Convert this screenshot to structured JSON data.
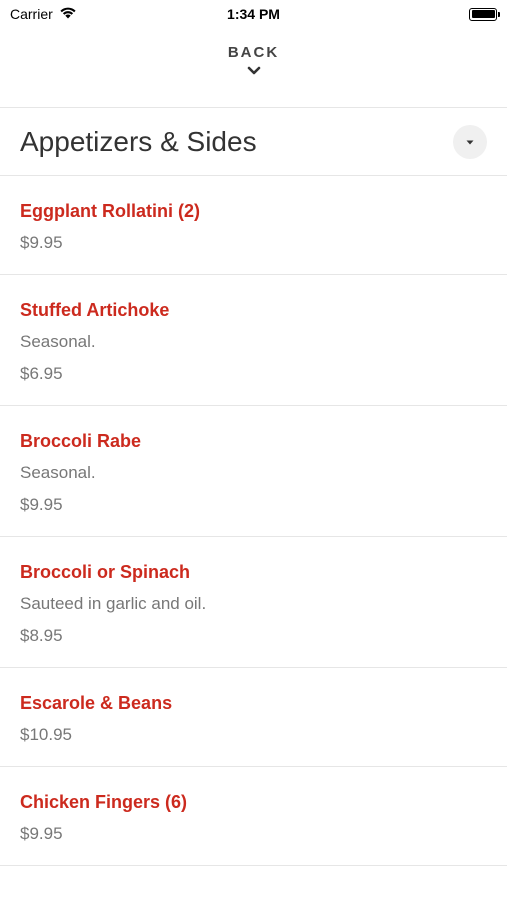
{
  "status_bar": {
    "carrier": "Carrier",
    "time": "1:34 PM"
  },
  "nav": {
    "back_label": "BACK"
  },
  "section": {
    "title": "Appetizers & Sides"
  },
  "items": [
    {
      "name": "Eggplant Rollatini (2)",
      "description": "",
      "price": "$9.95"
    },
    {
      "name": "Stuffed Artichoke",
      "description": "Seasonal.",
      "price": "$6.95"
    },
    {
      "name": "Broccoli Rabe",
      "description": "Seasonal.",
      "price": "$9.95"
    },
    {
      "name": "Broccoli or Spinach",
      "description": "Sauteed in garlic and oil.",
      "price": "$8.95"
    },
    {
      "name": "Escarole & Beans",
      "description": "",
      "price": "$10.95"
    },
    {
      "name": "Chicken Fingers (6)",
      "description": "",
      "price": "$9.95"
    }
  ],
  "colors": {
    "accent": "#cc2a1e",
    "text": "#333333",
    "muted": "#777777",
    "divider": "#e6e6e6"
  },
  "icons": {
    "wifi": "wifi-icon",
    "battery": "battery-icon",
    "chevron": "chevron-down-icon",
    "dropdown": "caret-down-icon"
  }
}
